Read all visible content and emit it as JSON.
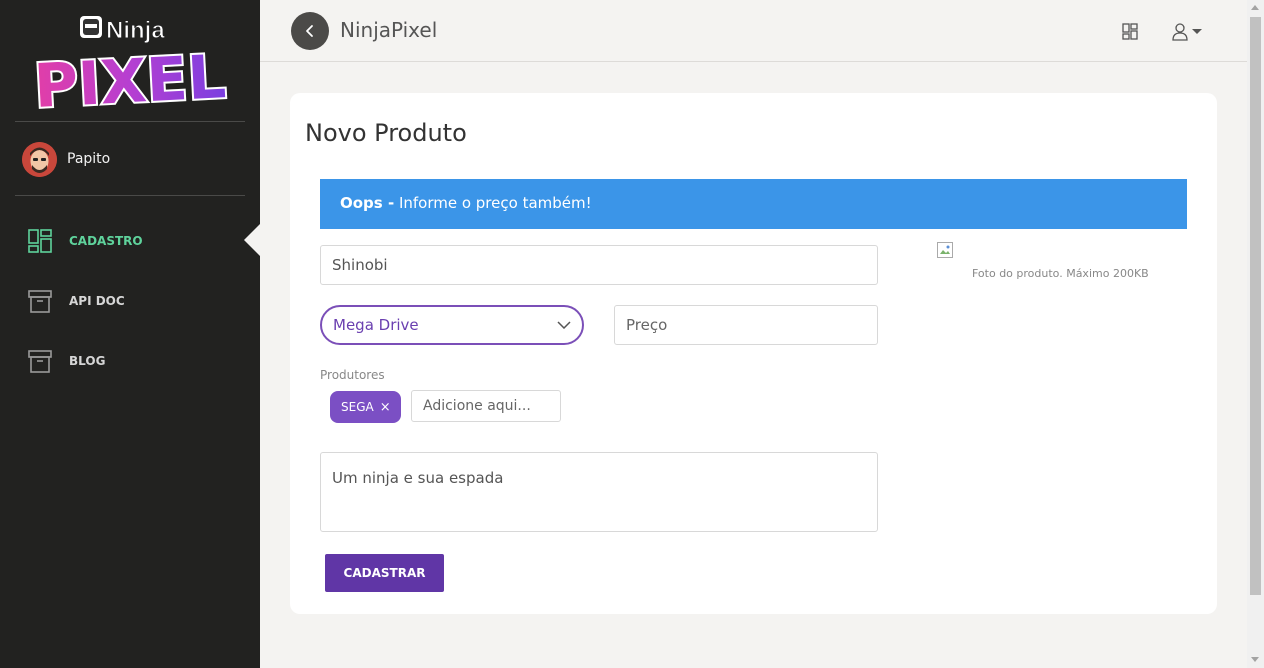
{
  "sidebar": {
    "logo_top": "Ninja",
    "logo_bottom": "PIXEL",
    "user_name": "Papito",
    "items": [
      {
        "label": "CADASTRO",
        "icon": "dashboard-icon",
        "active": true
      },
      {
        "label": "API DOC",
        "icon": "archive-icon",
        "active": false
      },
      {
        "label": "BLOG",
        "icon": "archive-icon",
        "active": false
      }
    ]
  },
  "topbar": {
    "title": "NinjaPixel"
  },
  "form": {
    "title": "Novo Produto",
    "alert_strong": "Oops -",
    "alert_text": " Informe o preço também!",
    "name_value": "Shinobi",
    "category_value": "Mega Drive",
    "price_placeholder": "Preço",
    "producers_label": "Produtores",
    "tag_label": "SEGA",
    "tag_remove": "×",
    "tag_placeholder": "Adicione aqui...",
    "description_value": "Um ninja e sua espada",
    "submit_label": "CADASTRAR",
    "photo_caption": "Foto do produto. Máximo 200KB"
  },
  "colors": {
    "sidebar_bg": "#222220",
    "active_nav": "#5fd39c",
    "alert_bg": "#3b95e8",
    "primary": "#6036a6",
    "tag_bg": "#7b4fc4"
  }
}
